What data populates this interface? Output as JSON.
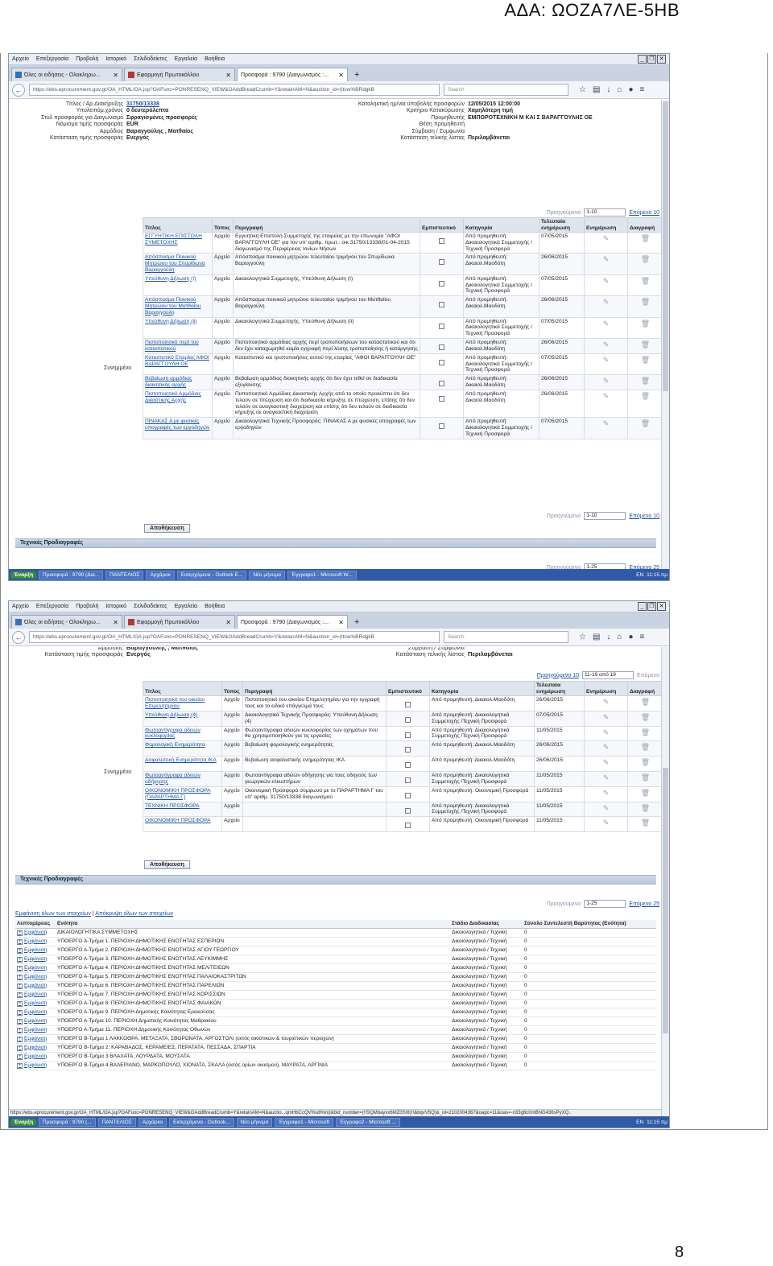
{
  "doc": {
    "ada": "ΑΔΑ: ΩΟΖΑ7ΛΕ-5ΗΒ",
    "page_number": "8"
  },
  "browser": {
    "menu": [
      "Αρχείο",
      "Επεξεργασία",
      "Προβολή",
      "Ιστορικό",
      "Σελιδοδείκτες",
      "Εργαλεία",
      "Βοήθεια"
    ],
    "tabs": [
      "Όλες οι ειδήσεις - Ολοκληρω...",
      "Εφαρμογή Πρωτοκόλλου",
      "Προσφορά : 9790 (Διαγωνισμός :..."
    ],
    "new_tab": "+",
    "url": "https://ebs.eprocurement.gov.gr/OA_HTML/OA.jsp?OAFunc=PONRESENQ_VIEW&OAddBreadCrumb=Y&retainAM=N&auction_id=(Itsw%BRdgkB",
    "search_placeholder": "Search",
    "icons": [
      "star-icon",
      "clipboard-icon",
      "download-icon",
      "home-icon",
      "chat-icon",
      "menu-icon"
    ]
  },
  "taskbar1": {
    "start": "Έναρξη",
    "tasks": [
      "Προσφορά : 9790 (Δια...",
      "ΠΑΝΤΕΛΙΟΣ",
      "Αρχάριοι",
      "Εισερχόμενα - Outlook E...",
      "Νέο μήνυμα",
      "Έγγραφο1 - Microsoft W..."
    ],
    "lang": "EN",
    "time": "11:15 πμ"
  },
  "taskbar2": {
    "start": "Έναρξη",
    "tasks": [
      "Προσφορά : 9790 (...",
      "ΠΑΝΤΕΛΙΟΣ",
      "Αρχάριοι",
      "Εισερχόμενα - Outlook...",
      "Νέο μήνυμα",
      "Έγγραφο1 - Microsoft",
      "Έγγραφο2 - Microsoft ..."
    ],
    "lang": "EN",
    "time": "11:15 πμ"
  },
  "header_info": {
    "left": [
      {
        "k": "Τίτλος / Αρ.Διακήρυξης",
        "v": "31750/13338"
      },
      {
        "k": "Υπολειπόμ.χρόνος",
        "v": "0 δευτερόλεπτα"
      },
      {
        "k": "Στυλ προσφοράς για Διαγωνισμό",
        "v": "Σφραγισμένες προσφορές"
      },
      {
        "k": "Νόμισμα τιμής προσφοράς",
        "v": "EUR"
      },
      {
        "k": "Αρμόδιος",
        "v": "Βαραγγούλης , Ματθαίος"
      },
      {
        "k": "Κατάσταση τιμής προσφοράς",
        "v": "Ενεργός"
      }
    ],
    "right": [
      {
        "k": "Καταληκτική ημ/νία υποβολής προσφορών",
        "v": "12/05/2015 12:00:00"
      },
      {
        "k": "Κριτήριο Κατακύρωσης",
        "v": "Χαμηλότερη τιμή"
      },
      {
        "k": "Προμηθευτής",
        "v": "ΕΜΠΟΡΟΤΕΧΝΙΚΗ Μ ΚΑΙ Σ ΒΑΡΑΓΓΟΥΛΗΣ ΟΕ"
      },
      {
        "k": "Θέση προμηθευτή",
        "v": ""
      },
      {
        "k": "Σύμβαση / Συμφωνία",
        "v": ""
      },
      {
        "k": "Κατάσταση τελικής λίστας",
        "v": "Περιλαμβάνεται"
      }
    ],
    "top_cut": "Αρμόδιος    Βαραγγούλης , Ματθαίος",
    "top_cut_right": "Σύμβαση / Συμφωνία"
  },
  "attachments_label": "Συνημμένο",
  "att_headers": [
    "Τίτλος",
    "Τύπος",
    "Περιγραφή",
    "Εμπιστευτικό",
    "Κατηγορία",
    "Τελευταία ενημέρωση",
    "Ενημέρωση",
    "Διαγραφή"
  ],
  "pager1": {
    "prev": "Προηγούμενο",
    "range": "1-10",
    "next": "Επόμενο 10"
  },
  "pager2": {
    "prev": "Προηγούμενο 10",
    "range": "11-19 από 19",
    "next": "Επόμενο"
  },
  "att_rows_1": [
    {
      "title": "ΕΓΓΥΗΤΙΚΗ ΕΠΙΣΤΟΛΗ ΣΥΜΕΤΟΧΗΣ",
      "type": "Αρχείο",
      "desc": "Εγγυητική Επιστολή Συμμετοχής της εταιρείας με την επωνυμία \"ΑΦΟΙ ΒΑΡΑΓΓΟΥΛΗ ΟΕ\" για τον υπ' αριθμ. πρωτ.: οικ.31750/13338/01-04-2015 διαγωνισμό της Περιφέρειας Ιονίων Νήσων",
      "cat": "Από προμηθευτή: Δικαιολογητικά Συμμετοχής /Τεχνική Προσφορά",
      "date": "07/05/2015"
    },
    {
      "title": "Απόσπασμα Ποινικού Μητρώου του Σπυρίδωνα Βαραγγούλη",
      "type": "Αρχείο",
      "desc": "Απόσπασμα ποινικού μητρώου τελευταίου τριμήνου του Σπυρίδωνα Βαραγγούλη",
      "cat": "Από προμηθευτή: Δικαιολ.Μαοδότη",
      "date": "26/06/2015"
    },
    {
      "title": "Υπεύθυνη Δήλωση (I)",
      "type": "Αρχείο",
      "desc": "Δικαιολογητικά Συμμετοχής, Υπεύθυνη Δήλωση (I)",
      "cat": "Από προμηθευτή: Δικαιολογητικά Συμμετοχής /Τεχνική Προσφορά",
      "date": "07/05/2015"
    },
    {
      "title": "Απόσπασμα Ποινικού Μητρώου του Ματθαίου Βαραγγούλη",
      "type": "Αρχείο",
      "desc": "Απόσπασμα ποινικού μητρώου τελευταίου τριμήνου του Ματθαίου Βαραγγούλη",
      "cat": "Από προμηθευτή: Δικαιολ.Μαοδότη",
      "date": "26/06/2015"
    },
    {
      "title": "Υπεύθυνη Δήλωση (ii)",
      "type": "Αρχείο",
      "desc": "Δικαιολογητικά Συμμετοχής, Υπεύθυνη Δήλωση (ii)",
      "cat": "Από προμηθευτή: Δικαιολογητικά Συμμετοχής /Τεχνική Προσφορά",
      "date": "07/05/2015"
    },
    {
      "title": "Πιστοποιητικό περί του καταστατικού",
      "type": "Αρχείο",
      "desc": "Πιστοποιητικό αρμόδιας αρχής περί τροποποιήσεων του καταστατικού και ότι δεν έχει καταχωρηθεί καμία εγγραφή περί λύσης τροποποίησης ή κατάργησης",
      "cat": "Από προμηθευτή: Δικαιολ.Μαοδότη",
      "date": "26/06/2015"
    },
    {
      "title": "Καταστατικό Εταιρίας ΑΦΟΙ ΒΑΡΑΓΓΟΥΛΗ ΟΕ",
      "type": "Αρχείο",
      "desc": "Καταστατικό και τροποποιήσεις αυτού της εταιρίας \"ΑΦΟΙ ΒΑΡΑΓΓΟΥΛΗ ΟΕ\"",
      "cat": "Από προμηθευτή: Δικαιολογητικά Συμμετοχής /Τεχνική Προσφορά",
      "date": "07/05/2015"
    },
    {
      "title": "Βεβαίωση αρμόδιας διοικητικής αρχής",
      "type": "Αρχείο",
      "desc": "Βεβαίωση αρμόδιας διοικητικής αρχής ότι δεν έχει τεθεί σε διαδικασία εξυγίανσης",
      "cat": "Από προμηθευτή: Δικαιολ.Μαοδότη",
      "date": "26/06/2015"
    },
    {
      "title": "Πιστοποιητικό Αρμόδιας Δικαστικής Αρχής",
      "type": "Αρχείο",
      "desc": "Πιστοποιητικό Αρμόδιας Δικαστικής Αρχής από το οποίο προκύπτει ότι δεν τελούν σε πτώχευση και ότι διαδικασία κήρυξης σε πτώχευση, επίσης ότι δεν τελούν σε αναγκαστική διαχείριση και επίσης ότι δεν τελούν σε διαδικασία κήρυξης σε αναγκαστική διαχείριση",
      "cat": "Από προμηθευτή: Δικαιολ.Μαοδότη",
      "date": "26/06/2015"
    },
    {
      "title": "ΠΙΝΑΚΑΣ Α με φυσικές υπογραφές των εργοδηγών",
      "type": "Αρχείο",
      "desc": "Δικαιολογητικά Τεχνικής Προσφοράς: ΠΙΝΑΚΑΣ Α με φυσικές υπογραφές των εργοδηγών",
      "cat": "Από προμηθευτή: Δικαιολογητικά Συμμετοχής /Τεχνική Προσφορά",
      "date": "07/05/2015"
    }
  ],
  "att_rows_2": [
    {
      "title": "Πιστοποιητικό του οικείου Επιμελητηρίου",
      "type": "Αρχείο",
      "desc": "Πιστοποιητικό του οικείου Επιμελητηρίου για την εγγραφή τους και το ειδικό επάγγελμά τους",
      "cat": "Από προμηθευτή: Δικαιολ.Μαοδότη",
      "date": "26/06/2015"
    },
    {
      "title": "Υπεύθυνη Δήλωση (4)",
      "type": "Αρχείο",
      "desc": "Δικαιολογητικά Τεχνικής Προσφοράς: Υπεύθυνη Δήλωση (4)",
      "cat": "Από προμηθευτή: Δικαιολογητικά Συμμετοχής /Τεχνική Προσφορά",
      "date": "07/05/2015"
    },
    {
      "title": "Φωτοαντίγραφα αδειών κυκλοφορίας",
      "type": "Αρχείο",
      "desc": "Φωτοαντίγραφα αδειών κυκλοφορίας των οχημάτων που θα χρησιμοποιηθούν για τις εργασίες",
      "cat": "Από προμηθευτή: Δικαιολογητικά Συμμετοχής /Τεχνική Προσφορά",
      "date": "11/05/2015"
    },
    {
      "title": "Φορολογική Ενημερότητα",
      "type": "Αρχείο",
      "desc": "Βεβαίωση φορολογικής ενημερότητας",
      "cat": "Από προμηθευτή: Δικαιολ.Μαοδότη",
      "date": "26/06/2015"
    },
    {
      "title": "Ασφαλιστική Ενημερότητα ΙΚΑ",
      "type": "Αρχείο",
      "desc": "Βεβαίωση ασφαλιστικής ενημερότητας ΙΚΑ",
      "cat": "Από προμηθευτή: Δικαιολ.Μαοδότη",
      "date": "26/06/2015"
    },
    {
      "title": "Φωτοαντίγραφα αδειών οδήγησης",
      "type": "Αρχείο",
      "desc": "Φωτοαντίγραφα αδειών οδήγησης για τους οδηγούς των γεωργικών ελκυστήρων",
      "cat": "Από προμηθευτή: Δικαιολογητικά Συμμετοχής /Τεχνική Προσφορά",
      "date": "11/05/2015"
    },
    {
      "title": "ΟΙΚΟΝΟΜΙΚΗ ΠΡΟΣΦΟΡΑ (ΠΑΡΑΡΤΗΜΑ Γ)",
      "type": "Αρχείο",
      "desc": "Οικονομική Προσφορά σύμφωνα με το ΠΑΡΑΡΤΗΜΑ Γ του υπ' αριθμ. 31750/13338 διαγωνισμού",
      "cat": "Από προμηθευτή: Οικονομική Προσφορά",
      "date": "11/05/2015"
    },
    {
      "title": "ΤΕΧΝΙΚΗ ΠΡΟΣΦΟΡΑ",
      "type": "Αρχείο",
      "desc": "",
      "cat": "Από προμηθευτή: Δικαιολογητικά Συμμετοχής /Τεχνική Προσφορά",
      "date": "11/05/2015"
    },
    {
      "title": "ΟΙΚΟΝΟΜΙΚΗ ΠΡΟΣΦΟΡΑ",
      "type": "Αρχείο",
      "desc": "",
      "cat": "Από προμηθευτή: Οικονομική Προσφορά",
      "date": "11/05/2015"
    }
  ],
  "save_button": "Αποθήκευση",
  "tech_section": "Τεχνικές Προδιαγραφές",
  "lots_pager": {
    "prev": "Προηγούμενο",
    "range": "1-25",
    "next": "Επόμενο 25"
  },
  "expand_all": "Εμφάνιση όλων των στοιχείων",
  "collapse_all": "Απόκρυψη όλων των στοιχείων",
  "lots_headers": [
    "Λεπτομέρειες",
    "Ενότητα",
    "Στάδιο Διαδικασίας",
    "Σύνολο Συντελεστή Βαρύτητας (Ενότητα)"
  ],
  "show_label": "Εμφάνιση",
  "lots_1": [
    {
      "name": "ΔΙΚΑΙΟΛΟΓΗΤΙΚΑ ΣΥΜΜΕΤΟΧΗΣ",
      "stage": "Δικαιολογητικά / Τεχνική",
      "w": "0"
    },
    {
      "name": "ΥΠΟΕΡΓΟ Α-Τμήμα 1. ΠΕΡΙΟΧΗ ΔΗΜΟΤΙΚΗΣ ΕΝΟΤΗΤΑΣ ΕΣΠΕΡΙΩΝ",
      "stage": "Δικαιολογητικά / Τεχνική",
      "w": "0"
    }
  ],
  "lots_2": [
    {
      "name": "ΔΙΚΑΙΟΛΟΓΗΤΙΚΑ ΣΥΜΜΕΤΟΧΗΣ",
      "stage": "Δικαιολογητικά / Τεχνική",
      "w": "0"
    },
    {
      "name": "ΥΠΟΕΡΓΟ Α-Τμήμα 1. ΠΕΡΙΟΧΗ ΔΗΜΟΤΙΚΗΣ ΕΝΟΤΗΤΑΣ ΕΣΠΕΡΙΩΝ",
      "stage": "Δικαιολογητικά / Τεχνική",
      "w": "0"
    },
    {
      "name": "ΥΠΟΕΡΓΟ Α-Τμήμα 2. ΠΕΡΙΟΧΗ ΔΗΜΟΤΙΚΗΣ ΕΝΟΤΗΤΑΣ ΑΓΙΟΥ ΓΕΩΡΓΙΟΥ",
      "stage": "Δικαιολογητικά / Τεχνική",
      "w": "0"
    },
    {
      "name": "ΥΠΟΕΡΓΟ Α-Τμήμα 3. ΠΕΡΙΟΧΗ ΔΗΜΟΤΙΚΗΣ ΕΝΟΤΗΤΑΣ ΛΕΥΚΙΜΜΗΣ",
      "stage": "Δικαιολογητικά / Τεχνική",
      "w": "0"
    },
    {
      "name": "ΥΠΟΕΡΓΟ Α-Τμήμα 4. ΠΕΡΙΟΧΗ ΔΗΜΟΤΙΚΗΣ ΕΝΟΤΗΤΑΣ ΜΕΛΙΤΕΙΕΩΝ",
      "stage": "Δικαιολογητικά / Τεχνική",
      "w": "0"
    },
    {
      "name": "ΥΠΟΕΡΓΟ Α-Τμήμα 5. ΠΕΡΙΟΧΗ ΔΗΜΟΤΙΚΗΣ ΕΝΟΤΗΤΑΣ ΠΑΛΑΙΟΚΑΣΤΡΙΤΩΝ",
      "stage": "Δικαιολογητικά / Τεχνική",
      "w": "0"
    },
    {
      "name": "ΥΠΟΕΡΓΟ Α-Τμήμα 6. ΠΕΡΙΟΧΗ ΔΗΜΟΤΙΚΗΣ ΕΝΟΤΗΤΑΣ ΠΑΡΕΛΙΩΝ",
      "stage": "Δικαιολογητικά / Τεχνική",
      "w": "0"
    },
    {
      "name": "ΥΠΟΕΡΓΟ Α-Τμήμα 7. ΠΕΡΙΟΧΗ ΔΗΜΟΤΙΚΗΣ ΕΝΟΤΗΤΑΣ ΚΟΡΙΣΣΙΩΝ",
      "stage": "Δικαιολογητικά / Τεχνική",
      "w": "0"
    },
    {
      "name": "ΥΠΟΕΡΓΟ Α-Τμήμα 8. ΠΕΡΙΟΧΗ ΔΗΜΟΤΙΚΗΣ ΕΝΟΤΗΤΑΣ ΦΑΙΑΚΩΝ",
      "stage": "Δικαιολογητικά / Τεχνική",
      "w": "0"
    },
    {
      "name": "ΥΠΟΕΡΓΟ Α-Τμήμα 9. ΠΕΡΙΟΧΗ Δημοτικής Κοινότητας Ερεικούσας",
      "stage": "Δικαιολογητικά / Τεχνική",
      "w": "0"
    },
    {
      "name": "ΥΠΟΕΡΓΟ Α-Τμήμα 10. ΠΕΡΙΟΧΗ Δημοτικής Κοινότητας Μαθρακίου",
      "stage": "Δικαιολογητικά / Τεχνική",
      "w": "0"
    },
    {
      "name": "ΥΠΟΕΡΓΟ Α-Τμήμα 11. ΠΕΡΙΟΧΗ Δημοτικής Κοινότητας Οθωνών",
      "stage": "Δικαιολογητικά / Τεχνική",
      "w": "0"
    },
    {
      "name": "ΥΠΟΕΡΓΟ Β-Τμήμα 1 ΛΑΚΚΟΘΡΑ, ΜΕΤΑΞΑΤΑ, ΣΒΟΡΩΝΑΤΑ, ΑΡΓΟΣΤΟΛΙ (εκτός οικιστικών & τουριστικών περιοχών)",
      "stage": "Δικαιολογητικά / Τεχνική",
      "w": "0"
    },
    {
      "name": "ΥΠΟΕΡΓΟ Β-Τμήμα 2: ΚΑΡΑΒΑΔΟΣ, ΚΕΡΑΜΕΙΕΣ, ΠΕΡΑΤΑΤΑ, ΠΕΣΣΑΔΑ, ΣΠΑΡΤΙΑ",
      "stage": "Δικαιολογητικά / Τεχνική",
      "w": "0"
    },
    {
      "name": "ΥΠΟΕΡΓΟ Β-Τμήμα 3 ΒΛΑΧΑΤΑ, ΛΟΥΡΔΑΤΑ, ΜΟΥΣΑΤΑ",
      "stage": "Δικαιολογητικά / Τεχνική",
      "w": "0"
    },
    {
      "name": "ΥΠΟΕΡΓΟ Β-Τμήμα 4 ΒΑΛΕΡΙΑΝΟ, ΜΑΡΚΟΠΟΥΛΟ, ΧΙΟΝΑΤΑ, ΣΚΑΛΑ (εκτός ορίων οικισμού), ΜΑΥΡΑΤΑ, ΑΡΓΙΝΙΑ",
      "stage": "Δικαιολογητικά / Τεχνική",
      "w": "0"
    }
  ],
  "status_url": "https://ebs.eprocurement.gov.gr/OA_HTML/OA.jsp?OAFunc=PONRESENQ_VIEW&OAddBreadCrumb=Y&retainAM=N&auctio...qmHbCcQV%u8%ni)&bid_number=(!!SQMbayxx6MZ0S!8)!!&bqvV5Q)&_id=2102004367&oapc=11&oas=-n33g6c0mBNG436sPyXQ.."
}
